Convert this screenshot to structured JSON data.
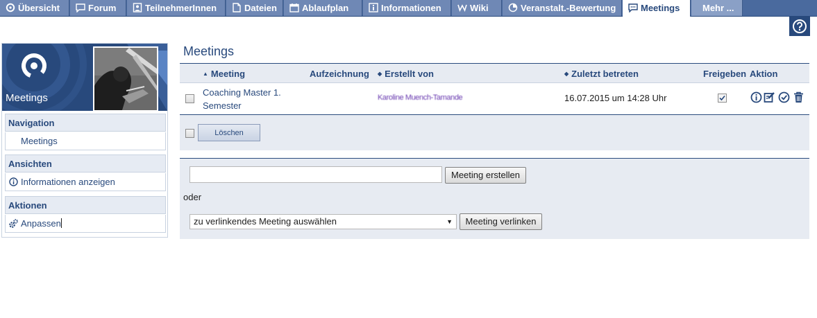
{
  "tabs": [
    {
      "label": "Übersicht",
      "icon": "overview-icon"
    },
    {
      "label": "Forum",
      "icon": "forum-icon"
    },
    {
      "label": "TeilnehmerInnen",
      "icon": "participants-icon"
    },
    {
      "label": "Dateien",
      "icon": "files-icon"
    },
    {
      "label": "Ablaufplan",
      "icon": "schedule-icon"
    },
    {
      "label": "Informationen",
      "icon": "info-icon"
    },
    {
      "label": "Wiki",
      "icon": "wiki-icon"
    },
    {
      "label": "Veranstalt.-Bewertung",
      "icon": "evaluation-icon"
    },
    {
      "label": "Meetings",
      "icon": "meetings-icon",
      "active": true
    },
    {
      "label": "Mehr ...",
      "icon": ""
    }
  ],
  "sidebar": {
    "title": "Meetings",
    "sections": [
      {
        "heading": "Navigation",
        "items": [
          {
            "label": "Meetings",
            "icon": ""
          }
        ]
      },
      {
        "heading": "Ansichten",
        "items": [
          {
            "label": "Informationen anzeigen",
            "icon": "info-icon"
          }
        ]
      },
      {
        "heading": "Aktionen",
        "items": [
          {
            "label": "Anpassen",
            "icon": "gears-icon"
          }
        ]
      }
    ]
  },
  "main": {
    "title": "Meetings",
    "table": {
      "columns": {
        "meeting": "Meeting",
        "recording": "Aufzeichnung",
        "created_by": "Erstellt von",
        "last_entered": "Zuletzt betreten",
        "share": "Freigeben",
        "action": "Aktion"
      },
      "rows": [
        {
          "meeting": "Coaching Master 1. Semester",
          "created_by": "Karoline Muench-Tamande",
          "last_entered": "16.07.2015 um 14:28 Uhr",
          "shared": true,
          "actions": [
            "info-icon",
            "edit-icon",
            "check-icon",
            "trash-icon"
          ]
        }
      ],
      "delete_label": "Löschen"
    },
    "create": {
      "input_value": "",
      "create_label": "Meeting erstellen",
      "or_label": "oder",
      "select_value": "zu verlinkendes Meeting auswählen",
      "link_label": "Meeting verlinken"
    }
  },
  "colors": {
    "brand": "#28497c",
    "tab_background": "#6f88b5",
    "panel_background": "#e7ebf2"
  }
}
